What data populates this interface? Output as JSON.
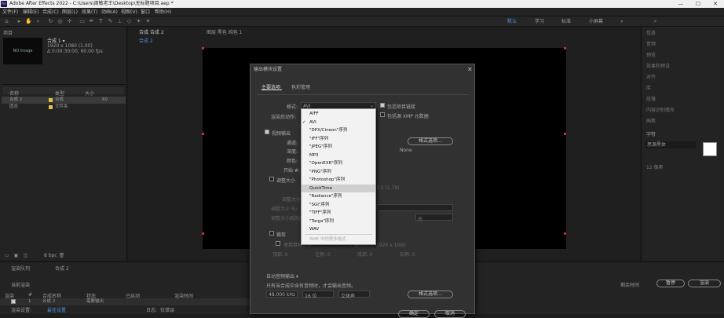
{
  "window": {
    "title": "Adobe After Effects 2022 - C:\\Users\\周敏老王\\Desktop\\无标题项目.aep *",
    "app_icon": "Ae",
    "controls": [
      "—",
      "☐",
      "✕"
    ]
  },
  "menu": [
    "文件(F)",
    "编辑(E)",
    "合成(C)",
    "图层(L)",
    "效果(T)",
    "动画(A)",
    "视图(V)",
    "窗口",
    "帮助(H)"
  ],
  "workspaces": [
    "默认",
    "学习",
    "标准",
    "小屏幕"
  ],
  "project": {
    "tab": "项目",
    "comp_name": "合成 1 ▾",
    "comp_info1": "1920 x 1080 (1.00)",
    "comp_info2": "Δ 0:00:30:00, 60.00 fps",
    "thumb_text": "NO Image",
    "columns": {
      "name": "名称",
      "type": "类型",
      "size": "大小"
    },
    "rows": [
      {
        "name": "合成 2",
        "type": "合成",
        "size": "60"
      },
      {
        "name": "固态",
        "type": "文件夹",
        "size": ""
      }
    ],
    "footer": "8 bpc"
  },
  "viewer": {
    "tab1": "合成 合成 2",
    "tab2": "图层 黑色 纯色 1",
    "subtab": "合成 2"
  },
  "right_panel": [
    "信息",
    "音频",
    "预览",
    "效果和预设",
    "对齐",
    "库",
    "段落",
    "内容识别填充",
    "画笔",
    "字符"
  ],
  "right_font": "思源黑体",
  "right_size": "12 像素",
  "timeline": {
    "tabs": [
      "渲染队列",
      "合成 2"
    ],
    "current": "当前渲染",
    "cols": [
      "渲染",
      "#",
      "合成名称",
      "状态",
      "已启动",
      "渲染时间"
    ],
    "row": {
      "num": "1",
      "name": "合成 2",
      "status": "需要输出"
    },
    "render_settings_label": "渲染设置:",
    "render_settings_val": "最佳设置",
    "log_label": "日志:",
    "log_val": "仅错误",
    "output_label": "输出到:",
    "right_btns": [
      "暂停",
      "渲染"
    ],
    "mini_cols": [
      "剩余时间"
    ]
  },
  "dialog": {
    "title": "输出模块设置",
    "tab_main": "主要选项",
    "tab_color": "色彩管理",
    "format_label": "格式:",
    "format_value": "AVI",
    "post_render_label": "渲染后动作:",
    "include_project": "包括项目链接",
    "include_xmp": "包括源 XMP 元数据",
    "video_output": "视频输出",
    "channel": "通道:",
    "depth": "深度:",
    "color": "颜色:",
    "start": "开始 #:",
    "none_text": "None",
    "format_options_btn": "格式选项...",
    "resize": "调整大小",
    "resize_to": "调整大小到:",
    "resize_pct": "调整大小 %:",
    "resize_quality": "调整大小后的品质:",
    "lock_ratio": "锁定长宽比",
    "crop": "裁剪",
    "use_roi": "使用目标区域",
    "final_size": "最终大小: 1920 x 1080",
    "crop_top": "顶部: 0",
    "crop_left": "左侧: 0",
    "crop_bottom": "底部: 0",
    "crop_right": "右侧: 0",
    "ratio_text": "1:1 (1.78)",
    "hq_text": "高",
    "auto_audio": "自动音频输出 ▾",
    "audio_note": "只有当合成中含有音频时，才会输出音频。",
    "sample_rate": "48.000 kHz",
    "bit": "16 位",
    "channels": "立体声",
    "audio_options_btn": "格式选项...",
    "ok": "确定",
    "cancel": "取消"
  },
  "dropdown": {
    "items": [
      "AIFF",
      "AVI",
      "\"DPX/Cineon\"序列",
      "\"IFF\"序列",
      "\"JPEG\"序列",
      "MP3",
      "\"OpenEXR\"序列",
      "\"PNG\"序列",
      "\"Photoshop\"序列",
      "QuickTime",
      "\"Radiance\"序列",
      "\"SGI\"序列",
      "\"TIFF\"序列",
      "\"Targa\"序列",
      "WAV",
      "AME 中的更多格式"
    ],
    "selected": "AVI",
    "highlighted": "QuickTime"
  }
}
